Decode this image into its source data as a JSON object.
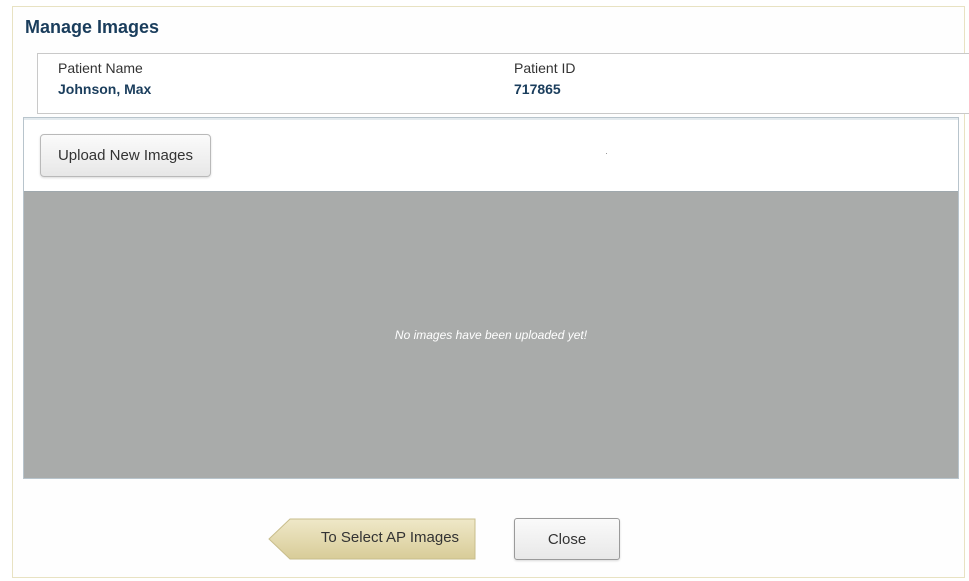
{
  "dialog": {
    "title": "Manage Images"
  },
  "patient": {
    "name_label": "Patient Name",
    "name_value": "Johnson, Max",
    "id_label": "Patient ID",
    "id_value": "717865"
  },
  "images": {
    "upload_label": "Upload New Images",
    "empty_message": "No images have been uploaded yet!"
  },
  "footer": {
    "back_label": "To Select AP Images",
    "close_label": "Close"
  },
  "colors": {
    "title": "#1a3d5c",
    "image_area_bg": "#a9abaa",
    "back_button_fill": "#e6ddb4"
  }
}
